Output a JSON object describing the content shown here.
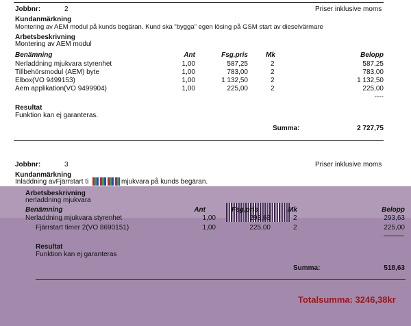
{
  "section1": {
    "jobbnr_label": "Jobbnr:",
    "jobbnr": "2",
    "price_note": "Priser inklusive moms",
    "kundanmarkning_label": "Kundanmärkning",
    "kundanmarkning": "Montering av AEM modul på kunds begäran. Kund ska \"bygga\" egen lösing på GSM start av dieselvärmare",
    "arbetsbeskrivning_label": "Arbetsbeskrivning",
    "arbetsbeskrivning": "Montering av AEM modul",
    "columns": {
      "benamning": "Benämning",
      "ant": "Ant",
      "fsgpris": "Fsg.pris",
      "mk": "Mk",
      "belopp": "Belopp"
    },
    "rows": [
      {
        "benamning": "Nerladdning mjukvara styrenhet",
        "ant": "1,00",
        "fsgpris": "587,25",
        "mk": "2",
        "belopp": "587,25"
      },
      {
        "benamning": "Tillbehörsmodul (AEM) byte",
        "ant": "1,00",
        "fsgpris": "783,00",
        "mk": "2",
        "belopp": "783,00"
      },
      {
        "benamning": "Elbox(VO 9499153)",
        "ant": "1,00",
        "fsgpris": "1 132,50",
        "mk": "2",
        "belopp": "1 132,50"
      },
      {
        "benamning": "Aem applikation(VO 9499904)",
        "ant": "1,00",
        "fsgpris": "225,00",
        "mk": "2",
        "belopp": "225,00"
      }
    ],
    "dashes": "----",
    "resultat_label": "Resultat",
    "resultat": "Funktion kan ej garanteras.",
    "summa_label": "Summa:",
    "summa": "2 727,75"
  },
  "section2": {
    "jobbnr_label": "Jobbnr:",
    "jobbnr": "3",
    "price_note": "Priser inklusive moms",
    "kundanmarkning_label": "Kundanmärkning",
    "kundanmarkning": "Inladdning avFjärrstart ti",
    "kundanmarkning_tail": "mjukvara på kunds begäran.",
    "arbetsbeskrivning_label": "Arbetsbeskrivning",
    "arbetsbeskrivning": "nerladdning mjukvara",
    "columns": {
      "benamning": "Benämning",
      "ant": "Ant",
      "fsgpris": "Fsg.pris",
      "mk": "Mk",
      "belopp": "Belopp"
    },
    "rows": [
      {
        "benamning": "Nerladdning mjukvara styrenhet",
        "ant": "1,00",
        "fsgpris": "293,63",
        "mk": "2",
        "belopp": "293,63"
      },
      {
        "benamning": "Fjärrstart timer 2(VO 8690151)",
        "ant": "1,00",
        "fsgpris": "225,00",
        "mk": "2",
        "belopp": "225,00"
      }
    ],
    "resultat_label": "Resultat",
    "resultat": "Funktion kan ej garanteras",
    "summa_label": "Summa:",
    "summa": "518,63"
  },
  "totalsumma": "Totalsumma: 3246,38kr",
  "colors": {
    "purple_top": "#b09ab8",
    "purple_bottom": "#a38aac",
    "total_red": "#a0141c"
  }
}
